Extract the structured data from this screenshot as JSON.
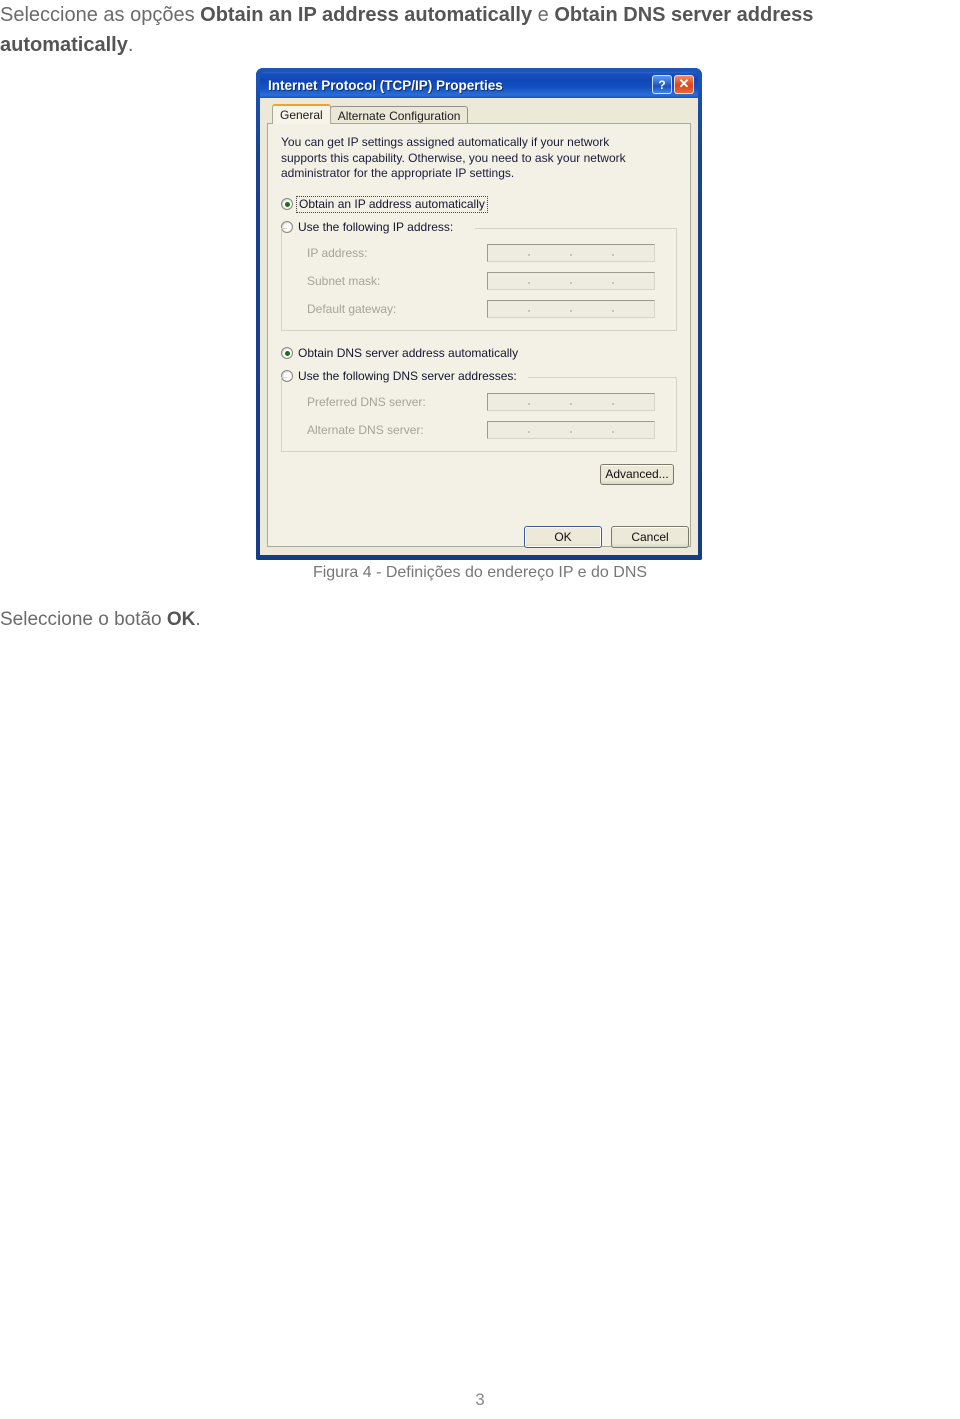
{
  "document": {
    "intro_prefix": "Seleccione as opções ",
    "intro_bold_1": "Obtain an IP address automatically",
    "intro_conj": " e ",
    "intro_bold_2": "Obtain DNS server address",
    "intro_bold_2_cont": "automatically",
    "intro_suffix": ".",
    "figure_caption": "Figura 4 - Definições do endereço IP e do DNS",
    "after_text_prefix": "Seleccione o botão ",
    "after_text_bold": "OK",
    "after_text_suffix": ".",
    "page_number": "3"
  },
  "dialog": {
    "title": "Internet Protocol (TCP/IP) Properties",
    "help_button": "?",
    "close_button": "✕",
    "tabs": [
      {
        "label": "General",
        "active": true
      },
      {
        "label": "Alternate Configuration",
        "active": false
      }
    ],
    "description": "You can get IP settings assigned automatically if your network supports this capability. Otherwise, you need to ask your network administrator for the appropriate IP settings.",
    "ip_section": {
      "radio_auto_label": "Obtain an IP address automatically",
      "radio_auto_selected": true,
      "radio_manual_label": "Use the following IP address:",
      "radio_manual_selected": false,
      "fields": [
        {
          "label": "IP address:",
          "value": ""
        },
        {
          "label": "Subnet mask:",
          "value": ""
        },
        {
          "label": "Default gateway:",
          "value": ""
        }
      ]
    },
    "dns_section": {
      "radio_auto_label": "Obtain DNS server address automatically",
      "radio_auto_selected": true,
      "radio_manual_label": "Use the following DNS server addresses:",
      "radio_manual_selected": false,
      "fields": [
        {
          "label": "Preferred DNS server:",
          "value": ""
        },
        {
          "label": "Alternate DNS server:",
          "value": ""
        }
      ]
    },
    "advanced_button": "Advanced...",
    "ok_button": "OK",
    "cancel_button": "Cancel"
  },
  "colors": {
    "titlebar_blue": "#0f46b8",
    "window_border": "#123a8f",
    "client_bg": "#ece9d8",
    "tab_active_accent": "#e8a33d",
    "radio_dot_green": "#1e6b1e",
    "close_red": "#d8451a",
    "body_text_grey": "#6b6b6b"
  }
}
